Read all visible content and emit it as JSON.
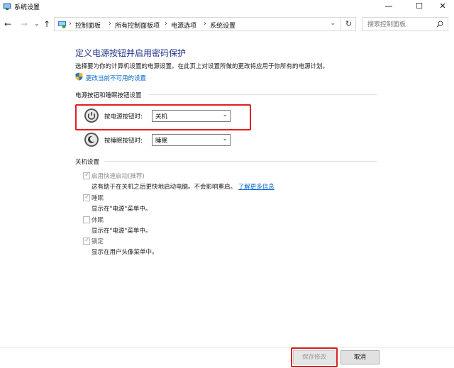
{
  "window": {
    "title": "系统设置",
    "minimize": "—",
    "maximize": "☐",
    "close": "✕"
  },
  "nav": {
    "back": "←",
    "forward": "→",
    "dropdown": "⌄",
    "up": "↑"
  },
  "breadcrumb": {
    "items": [
      "控制面板",
      "所有控制面板项",
      "电源选项",
      "系统设置"
    ],
    "separator": "›",
    "dropdown": "⌄",
    "refresh": "↻"
  },
  "search": {
    "placeholder": "搜索控制面板"
  },
  "page": {
    "title": "定义电源按钮并启用密码保护",
    "description": "选择要为你的计算机设置的电源设置。在此页上对设置所做的更改将应用于你所有的电源计划。",
    "change_link": "更改当前不可用的设置"
  },
  "power_section": {
    "title": "电源按钮和睡眠按钮设置",
    "power_button": {
      "label": "按电源按钮时:",
      "value": "关机"
    },
    "sleep_button": {
      "label": "按睡眠按钮时:",
      "value": "睡眠"
    },
    "combo_arrow": "⌄"
  },
  "shutdown_section": {
    "title": "关机设置",
    "options": [
      {
        "label": "启用快速启动(推荐)",
        "desc": "这有助于在关机之后更快地启动电脑。不会影响重启。",
        "link": "了解更多信息",
        "checked": true,
        "disabled": true
      },
      {
        "label": "睡眠",
        "desc": "显示在\"电源\"菜单中。",
        "checked": true,
        "disabled": true
      },
      {
        "label": "休眠",
        "desc": "显示在\"电源\"菜单中。",
        "checked": false,
        "disabled": true
      },
      {
        "label": "锁定",
        "desc": "显示在用户头像菜单中。",
        "checked": true,
        "disabled": true
      }
    ],
    "check_mark": "✓"
  },
  "footer": {
    "save_label": "保存修改",
    "cancel_label": "取消"
  },
  "colors": {
    "heading": "#1e3287",
    "link": "#0066cc",
    "highlight": "#e02020",
    "disabled_text": "#8a8a8a"
  }
}
